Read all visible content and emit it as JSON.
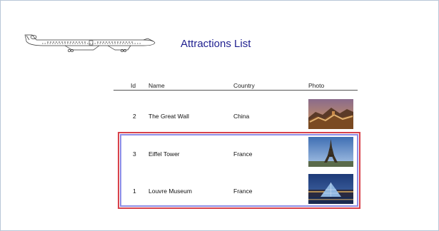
{
  "report": {
    "title": "Attractions List",
    "columns": {
      "id": "Id",
      "name": "Name",
      "country": "Country",
      "photo": "Photo"
    },
    "rows": [
      {
        "id": "2",
        "name": "The Great Wall",
        "country": "China",
        "photo_icon": "great-wall-photo"
      },
      {
        "id": "3",
        "name": "Eiffel Tower",
        "country": "France",
        "photo_icon": "eiffel-tower-photo"
      },
      {
        "id": "1",
        "name": "Louvre Museum",
        "country": "France",
        "photo_icon": "louvre-pyramid-photo"
      }
    ],
    "colors": {
      "title": "#1f1f8f",
      "selection_outer": "#d8434b",
      "selection_inner": "#8e8de6"
    }
  }
}
